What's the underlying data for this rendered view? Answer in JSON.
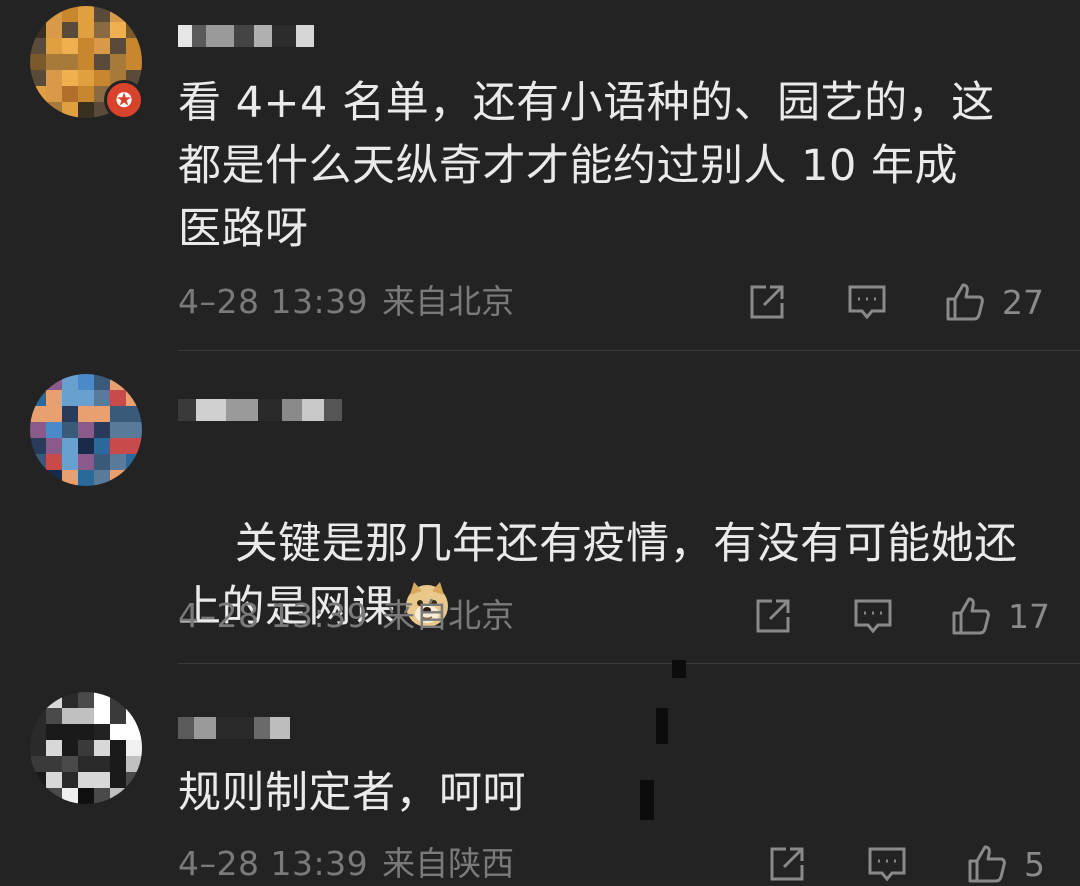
{
  "comments": [
    {
      "text": "看 4+4 名单，还有小语种的、园艺的，这\n都是什么天纵奇才才能约过别人 10 年成\n医路呀",
      "time": "4–28 13:39",
      "location": "来自北京",
      "like_count": "27",
      "has_badge": true,
      "badge_icon": "star-badge-icon"
    },
    {
      "text": "关键是那几年还有疫情，有没有可能她还\n上的是网课",
      "emoji": "doge-emoji",
      "time": "4–28 13:39",
      "location": "来自北京",
      "like_count": "17"
    },
    {
      "text": "规则制定者，呵呵",
      "time": "4–28 13:39",
      "location": "来自陕西",
      "like_count": "5"
    }
  ],
  "colors": {
    "background": "#232323",
    "text": "#eaeaea",
    "meta": "#7a7a7a",
    "badge": "#d8432c"
  }
}
